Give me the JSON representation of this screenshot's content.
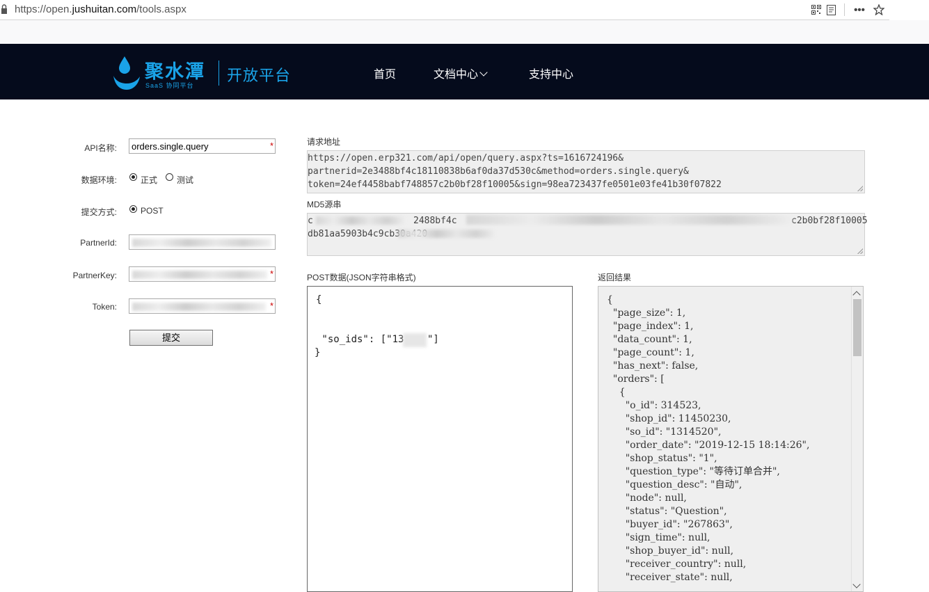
{
  "browser": {
    "url_prefix": "https://open.",
    "url_domain": "jushuitan.com",
    "url_path": "/tools.aspx"
  },
  "header": {
    "brand": "聚水潭",
    "brand_sub": "SaaS 协同平台",
    "open_platform": "开放平台",
    "nav": {
      "home": "首页",
      "docs": "文档中心",
      "support": "支持中心"
    },
    "bg_color": "#050b1c",
    "accent_color": "#1aa3e8"
  },
  "form": {
    "api_name_label": "API名称:",
    "api_name_value": "orders.single.query",
    "required_mark": "*",
    "env_label": "数据环境:",
    "env_options": [
      "正式",
      "测试"
    ],
    "env_selected": "正式",
    "method_label": "提交方式:",
    "method_value": "POST",
    "partner_id_label": "PartnerId:",
    "partner_key_label": "PartnerKey:",
    "token_label": "Token:",
    "submit_label": "提交"
  },
  "request_url": {
    "title": "请求地址",
    "lines": [
      "https://open.erp321.com/api/open/query.aspx?ts=1616724196&",
      "partnerid=2e3488bf4c18110838b6af0da37d530c&method=orders.single.query&",
      "token=24ef4458babf748857c2b0bf28f10005&sign=98ea723437fe0501e03fe41b30f07822"
    ]
  },
  "md5": {
    "title": "MD5源串",
    "line1_start": "c",
    "line1_mid": "2488bf4c",
    "line1_end": "c2b0bf28f10005",
    "line2": "db81aa5903b4c9cb30a420"
  },
  "post": {
    "title": "POST数据(JSON字符串格式)",
    "lines": [
      "{",
      "",
      "",
      " \"so_ids\": [\"13",
      "}"
    ],
    "line4_end": "\"]"
  },
  "result": {
    "title": "返回结果",
    "lines": [
      "{",
      "  \"page_size\": 1,",
      "  \"page_index\": 1,",
      "  \"data_count\": 1,",
      "  \"page_count\": 1,",
      "  \"has_next\": false,",
      "  \"orders\": [",
      "    {",
      "      \"o_id\": 314523,",
      "      \"shop_id\": 11450230,",
      "      \"so_id\": \"1314520\",",
      "      \"order_date\": \"2019-12-15 18:14:26\",",
      "      \"shop_status\": \"1\",",
      "      \"question_type\": \"等待订单合并\",",
      "      \"question_desc\": \"自动\",",
      "      \"node\": null,",
      "      \"status\": \"Question\",",
      "      \"buyer_id\": \"267863\",",
      "      \"sign_time\": null,",
      "      \"shop_buyer_id\": null,",
      "      \"receiver_country\": null,",
      "      \"receiver_state\": null,"
    ]
  }
}
